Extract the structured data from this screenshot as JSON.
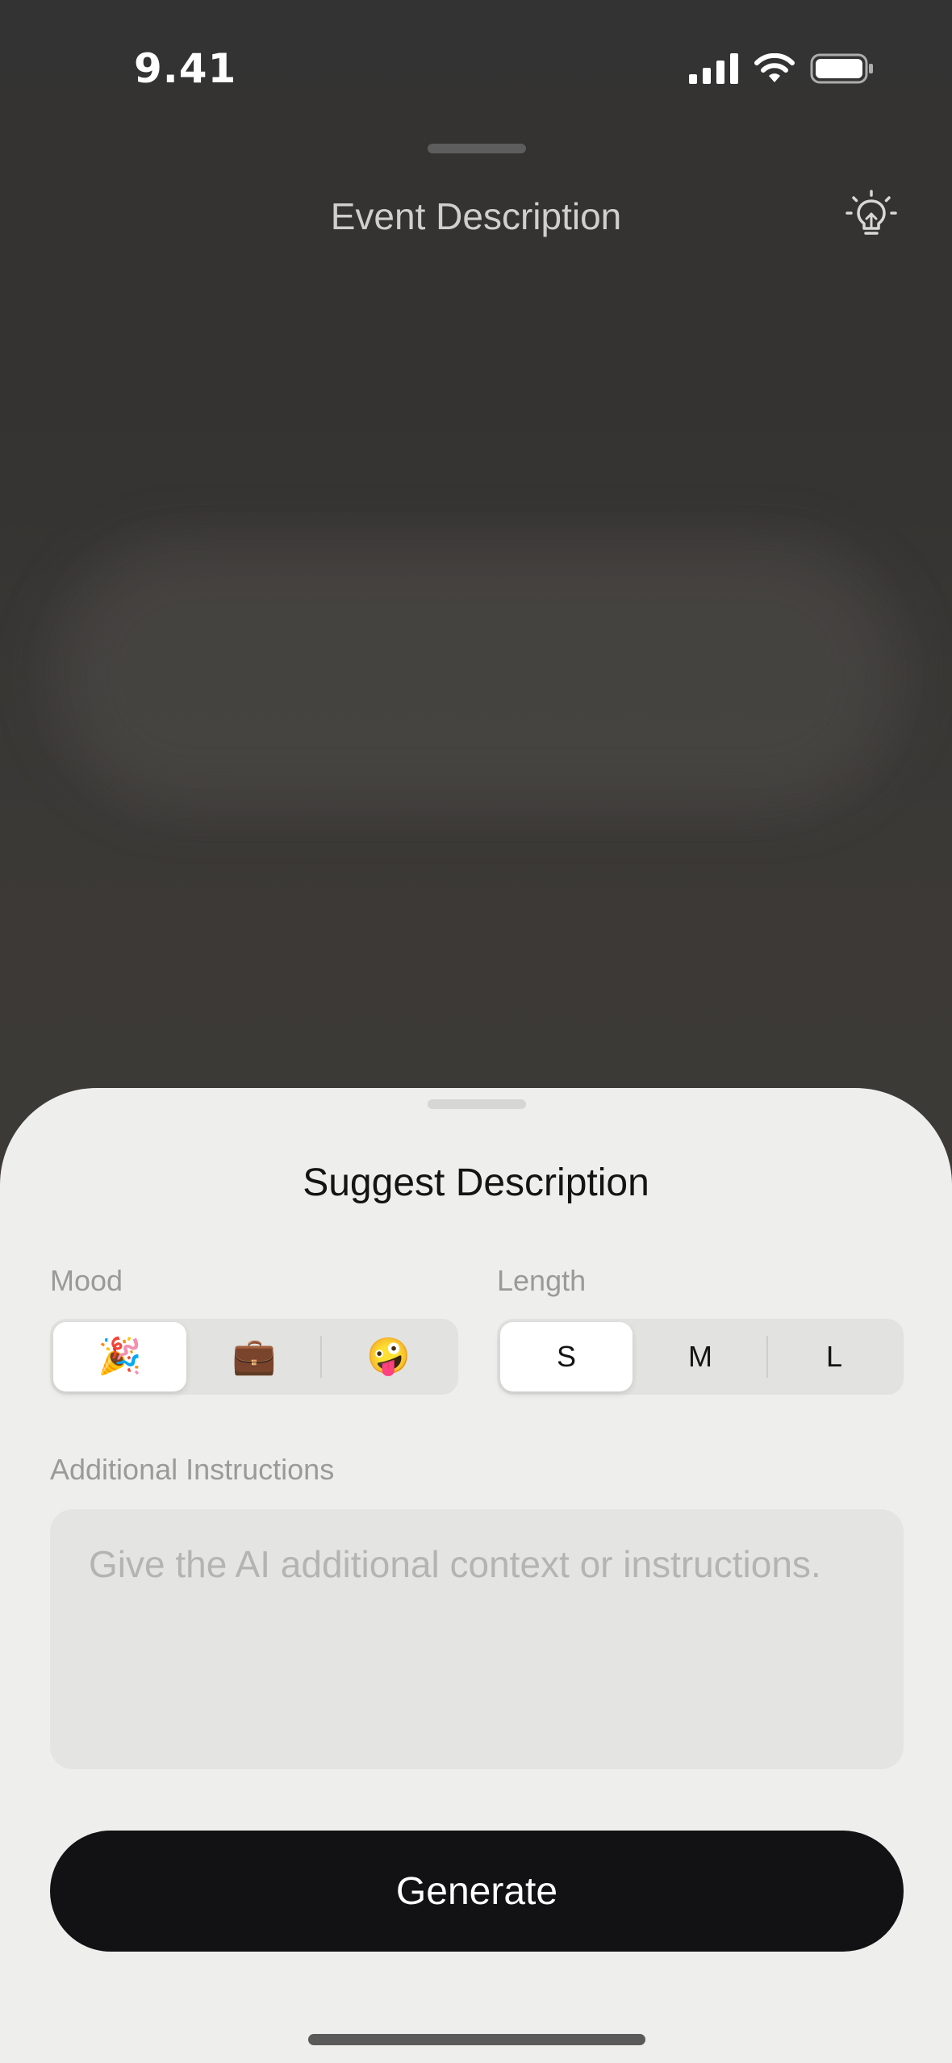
{
  "status_bar": {
    "time": "9.41"
  },
  "header": {
    "title": "Event Description",
    "icon": "lightbulb-icon"
  },
  "sheet": {
    "title": "Suggest Description",
    "mood": {
      "label": "Mood",
      "options": [
        {
          "icon": "party-popper-icon",
          "glyph": "🎉",
          "selected": true
        },
        {
          "icon": "briefcase-icon",
          "glyph": "💼",
          "selected": false
        },
        {
          "icon": "zany-face-icon",
          "glyph": "🤪",
          "selected": false
        }
      ]
    },
    "length": {
      "label": "Length",
      "options": [
        {
          "label": "S",
          "selected": true
        },
        {
          "label": "M",
          "selected": false
        },
        {
          "label": "L",
          "selected": false
        }
      ]
    },
    "instructions": {
      "label": "Additional Instructions",
      "value": "",
      "placeholder": "Give the AI additional context or instructions."
    },
    "generate_label": "Generate"
  },
  "colors": {
    "sheet_background": "#eeeeec",
    "button_background": "#121214",
    "label_gray": "#9a9a98",
    "placeholder_gray": "#b4b4b2"
  }
}
